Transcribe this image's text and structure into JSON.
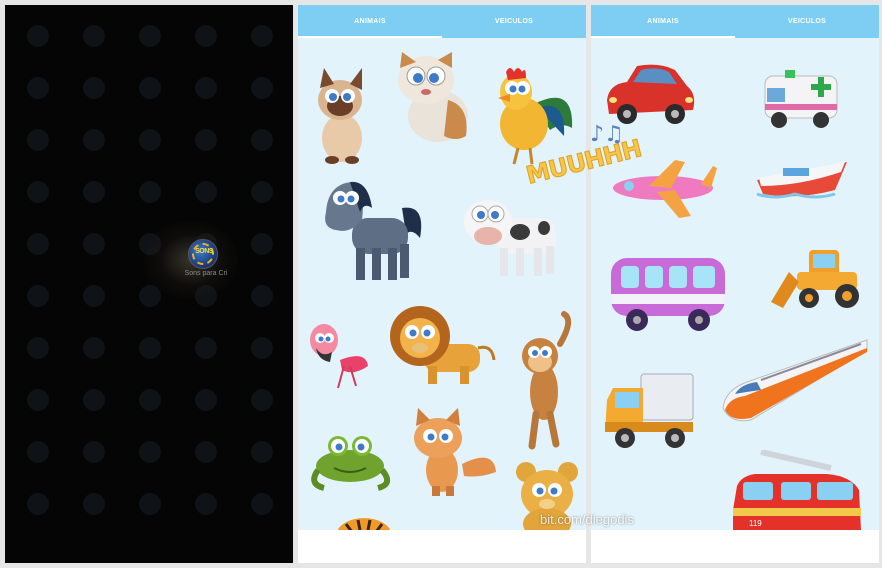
{
  "splash": {
    "app_icon_text": "SONS",
    "app_label": "Sons para Cri"
  },
  "tabs": [
    {
      "label": "ANIMAIS",
      "active": true
    },
    {
      "label": "VEICULOS",
      "active": false
    }
  ],
  "animals_panel": {
    "active_tab": "ANIMAIS",
    "items": [
      "cat-siamese",
      "cat-tabby",
      "rooster",
      "horse",
      "cow",
      "flamingo",
      "lion",
      "monkey",
      "frog",
      "fox",
      "bear",
      "tiger"
    ]
  },
  "vehicles_panel": {
    "active_tab": "ANIMAIS",
    "items": [
      "car",
      "ambulance",
      "airplane",
      "boat",
      "bus",
      "bulldozer",
      "truck",
      "train",
      "fire-truck"
    ]
  },
  "overlay": {
    "sound_text": "MUUHHH",
    "watermark": "bit.com/diegodis"
  },
  "colors": {
    "tab_bar": "#7ecdf2",
    "content_bg": "#e2f3fb",
    "tab_text": "#ffffff"
  }
}
